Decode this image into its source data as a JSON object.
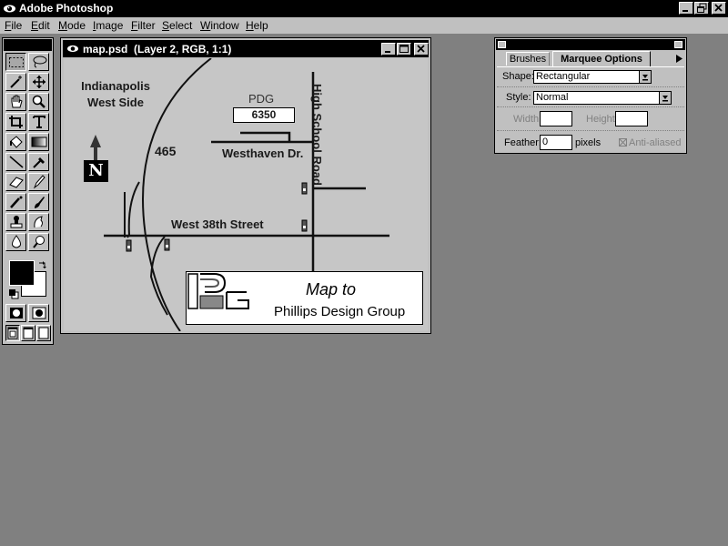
{
  "app": {
    "title": "Adobe Photoshop"
  },
  "menu": {
    "items": [
      "File",
      "Edit",
      "Mode",
      "Image",
      "Filter",
      "Select",
      "Window",
      "Help"
    ]
  },
  "document": {
    "title": "map.psd  (Layer 2, RGB, 1:1)",
    "map": {
      "city_line1": "Indianapolis",
      "city_line2": "West Side",
      "highway": "465",
      "building": "PDG",
      "address": "6350",
      "street_westhaven": "Westhaven Dr.",
      "street_38th": "West 38th Street",
      "street_highschool": "High School Road",
      "north": "N",
      "legend_title": "Map to",
      "legend_company": "Phillips Design Group"
    }
  },
  "options_panel": {
    "tabs": [
      "Brushes",
      "Marquee Options"
    ],
    "shape_label": "Shape:",
    "shape_value": "Rectangular",
    "style_label": "Style:",
    "style_value": "Normal",
    "width_label": "Width:",
    "height_label": "Height:",
    "feather_label": "Feather:",
    "feather_value": "0",
    "feather_unit": "pixels",
    "antialias_label": "Anti-aliased"
  },
  "colors": {
    "desktop": "#808080",
    "chrome": "#c0c0c0",
    "titlebar": "#000000",
    "canvas": "#c6c6c6"
  },
  "icons": {
    "app": "photoshop-eye-icon",
    "tools": [
      "rect-marquee",
      "lasso",
      "magic-wand",
      "move",
      "hand",
      "zoom",
      "crop",
      "type",
      "paint-bucket",
      "gradient",
      "line",
      "eyedropper",
      "eraser",
      "pencil",
      "airbrush",
      "paintbrush",
      "rubber-stamp",
      "smudge",
      "blur",
      "dodge"
    ]
  }
}
